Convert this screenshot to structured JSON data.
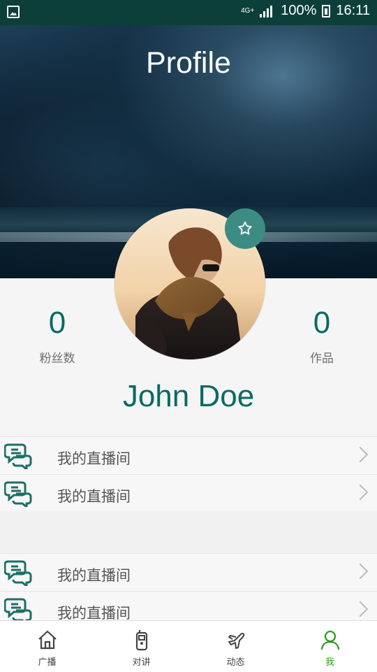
{
  "status_bar": {
    "network": "4G+",
    "battery": "100%",
    "time": "16:11"
  },
  "header": {
    "title": "Profile"
  },
  "profile": {
    "followers_count": "0",
    "followers_label": "粉丝数",
    "works_count": "0",
    "works_label": "作品",
    "name": "John Doe"
  },
  "menu_sections": [
    {
      "items": [
        {
          "label": "我的直播间"
        },
        {
          "label": "我的直播间"
        }
      ]
    },
    {
      "items": [
        {
          "label": "我的直播间"
        },
        {
          "label": "我的直播间"
        }
      ]
    }
  ],
  "bottom_nav": [
    {
      "label": "广播",
      "icon": "home-icon"
    },
    {
      "label": "对讲",
      "icon": "walkie-talkie-icon"
    },
    {
      "label": "动态",
      "icon": "airplane-icon"
    },
    {
      "label": "我",
      "icon": "user-icon",
      "active": true
    }
  ],
  "colors": {
    "primary": "#0a6a63",
    "active_tab": "#2f9b20",
    "status_bar": "#0d3f3a"
  }
}
